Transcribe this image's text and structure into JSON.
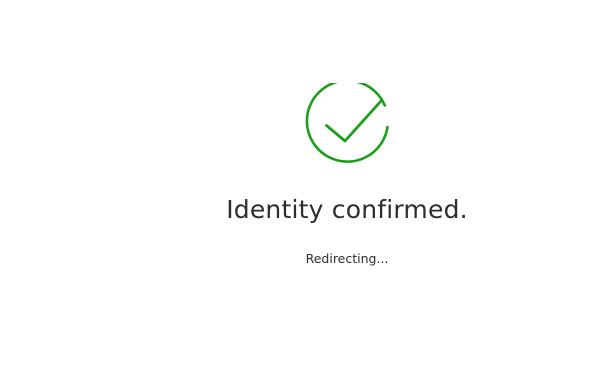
{
  "status": {
    "icon": "check-circle-icon",
    "title": "Identity confirmed.",
    "subtitle": "Redirecting..."
  },
  "colors": {
    "accent": "#1a9f1a",
    "text": "#2c2e2f",
    "background": "#ffffff"
  }
}
